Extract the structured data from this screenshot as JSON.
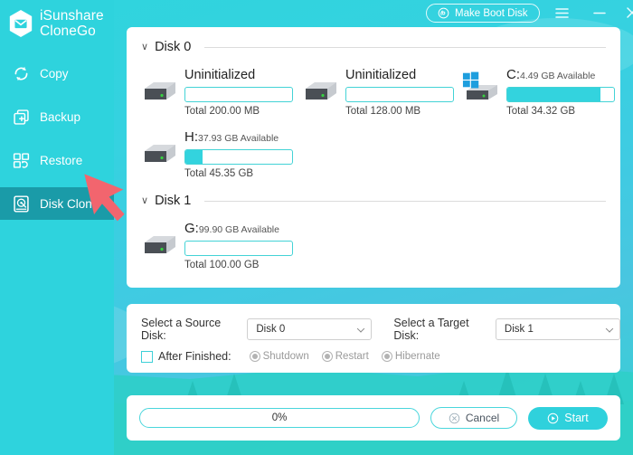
{
  "app": {
    "brand_line1": "iSunshare",
    "brand_line2": "CloneGo",
    "logo_icon": "hexagon-envelope-logo",
    "accent_color": "#2ed3dd",
    "active_nav_color": "#1a9ba8",
    "panel_bg": "#ffffff"
  },
  "titlebar": {
    "make_boot_disk_label": "Make Boot Disk",
    "boot_icon": "disc-icon",
    "menu_icon": "hamburger-icon",
    "minimize_icon": "minimize-icon",
    "close_icon": "close-icon"
  },
  "sidebar": {
    "items": [
      {
        "label": "Copy",
        "icon": "refresh-cycle-icon",
        "active": false
      },
      {
        "label": "Backup",
        "icon": "copy-plus-icon",
        "active": false
      },
      {
        "label": "Restore",
        "icon": "restore-blocks-icon",
        "active": false
      },
      {
        "label": "Disk Clone",
        "icon": "hard-disk-icon",
        "active": true
      }
    ]
  },
  "disk_panel": {
    "groups": [
      {
        "title": "Disk 0",
        "caret": "∨",
        "partitions": [
          {
            "letter": "",
            "label": "Uninitialized",
            "available": "",
            "total": "Total 200.00 MB",
            "fill_percent": 0,
            "icon": "hard-drive-icon",
            "has_windows_flag": false
          },
          {
            "letter": "",
            "label": "Uninitialized",
            "available": "",
            "total": "Total 128.00 MB",
            "fill_percent": 0,
            "icon": "hard-drive-icon",
            "has_windows_flag": false
          },
          {
            "letter": "C:",
            "label": "",
            "available": "4.49 GB Available",
            "total": "Total 34.32 GB",
            "fill_percent": 87,
            "icon": "hard-drive-icon",
            "has_windows_flag": true
          },
          {
            "letter": "H:",
            "label": "",
            "available": "37.93 GB Available",
            "total": "Total 45.35 GB",
            "fill_percent": 16,
            "icon": "hard-drive-icon",
            "has_windows_flag": false
          }
        ]
      },
      {
        "title": "Disk 1",
        "caret": "∨",
        "partitions": [
          {
            "letter": "G:",
            "label": "",
            "available": "99.90 GB Available",
            "total": "Total 100.00 GB",
            "fill_percent": 0,
            "icon": "hard-drive-icon",
            "has_windows_flag": false
          }
        ]
      }
    ]
  },
  "options": {
    "source_label": "Select a Source Disk:",
    "source_value": "Disk 0",
    "target_label": "Select a Target Disk:",
    "target_value": "Disk 1",
    "after_finished_label": "After Finished:",
    "after_finished_checked": false,
    "radios": [
      {
        "label": "Shutdown",
        "selected": false,
        "disabled": true
      },
      {
        "label": "Restart",
        "selected": false,
        "disabled": true
      },
      {
        "label": "Hibernate",
        "selected": false,
        "disabled": true
      }
    ]
  },
  "actions": {
    "progress_text": "0%",
    "progress_percent": 0,
    "cancel_label": "Cancel",
    "cancel_icon": "circle-x-icon",
    "start_label": "Start",
    "start_icon": "circle-play-icon"
  },
  "annotation": {
    "pointer_icon": "red-arrow-pointer",
    "pointer_color": "#f2656e"
  }
}
